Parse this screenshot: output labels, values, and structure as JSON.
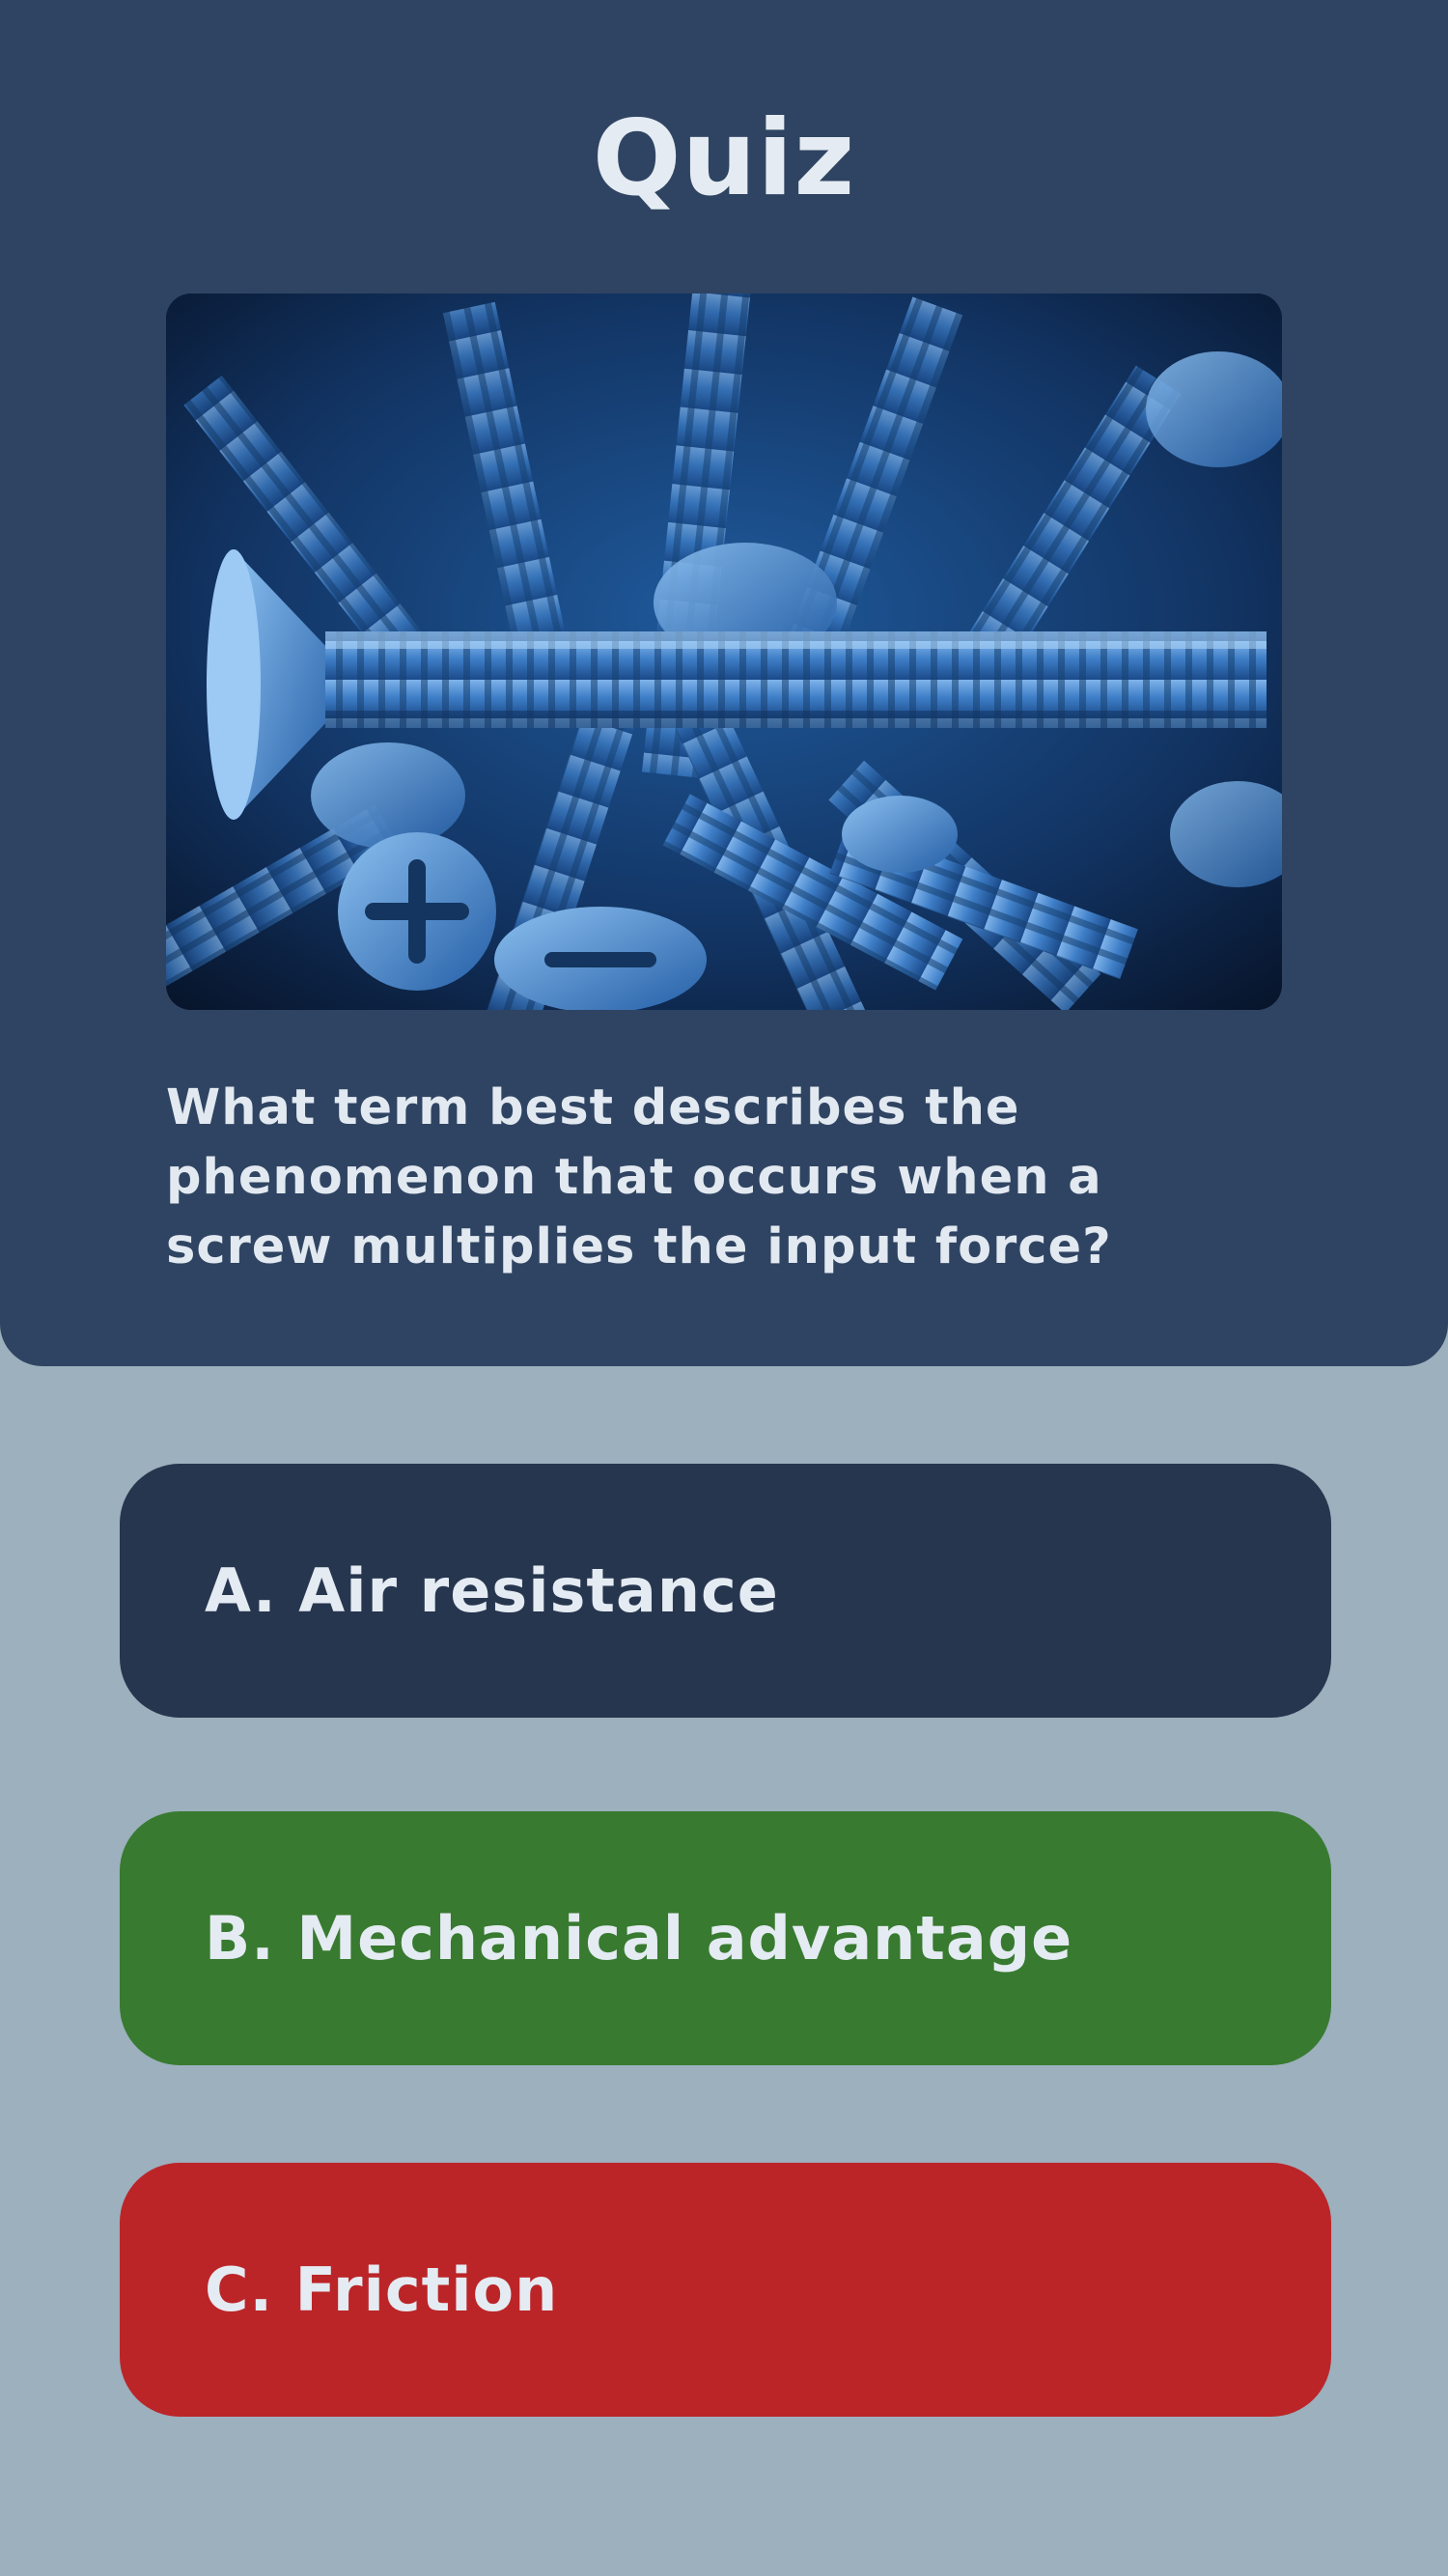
{
  "quiz": {
    "title": "Quiz",
    "image": {
      "icon": "screws-photo"
    },
    "question": "What term best describes the phenomenon that occurs when a screw multiplies the input force?",
    "answers": [
      {
        "label": "A. Air resistance",
        "color": "#27364f"
      },
      {
        "label": "B. Mechanical advantage",
        "color": "#387a30"
      },
      {
        "label": "C. Friction",
        "color": "#bb2528"
      }
    ]
  },
  "colors": {
    "page_background": "#9cb0bd",
    "header_background": "#2f4462",
    "text": "#e4ebf2"
  }
}
